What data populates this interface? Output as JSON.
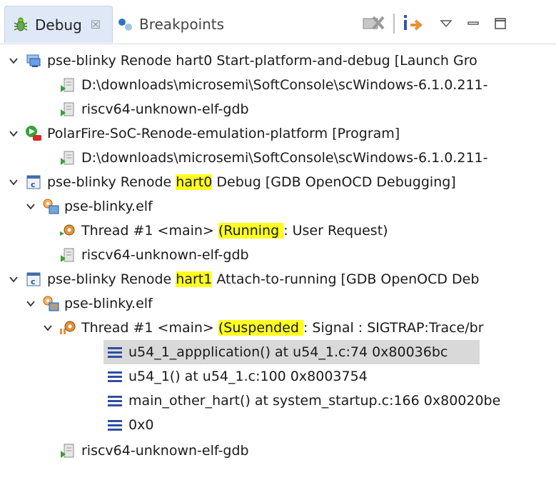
{
  "tabs": {
    "debug_label": "Debug",
    "debug_close": "☒",
    "breakpoints_label": "Breakpoints"
  },
  "tree": {
    "r1": {
      "text": "pse-blinky Renode hart0 Start-platform-and-debug [Launch Gro"
    },
    "r2": {
      "text": "D:\\downloads\\microsemi\\SoftConsole\\scWindows-6.1.0.211-"
    },
    "r3": {
      "text": "riscv64-unknown-elf-gdb"
    },
    "r4": {
      "text": "PolarFire-SoC-Renode-emulation-platform [Program]"
    },
    "r5": {
      "text": "D:\\downloads\\microsemi\\SoftConsole\\scWindows-6.1.0.211-"
    },
    "r6": {
      "pre": "pse-blinky Renode ",
      "hl": "hart0",
      "post": " Debug [GDB OpenOCD Debugging]"
    },
    "r7": {
      "text": "pse-blinky.elf"
    },
    "r8": {
      "pre": "Thread #1 <main> ",
      "hl": "(Running ",
      "post": ": User Request)"
    },
    "r9": {
      "text": "riscv64-unknown-elf-gdb"
    },
    "r10": {
      "pre": "pse-blinky Renode ",
      "hl": "hart1",
      "post": " Attach-to-running [GDB OpenOCD Deb"
    },
    "r11": {
      "text": "pse-blinky.elf"
    },
    "r12": {
      "pre": "Thread #1 <main> ",
      "hl": "(Suspended ",
      "post": ": Signal : SIGTRAP:Trace/br"
    },
    "r13": {
      "text": "u54_1_appplication() at u54_1.c:74 0x80036bc"
    },
    "r14": {
      "text": "u54_1() at u54_1.c:100 0x8003754"
    },
    "r15": {
      "text": "main_other_hart() at system_startup.c:166 0x80020be"
    },
    "r16": {
      "text": "0x0"
    },
    "r17": {
      "text": "riscv64-unknown-elf-gdb"
    }
  },
  "colors": {
    "highlight": "#ffff22",
    "selection": "#d9d9d9",
    "tab_active_bg": "#dfe8f6",
    "stack_frame_icon": "#2f4f9e"
  },
  "icons": [
    "debug-bug-icon",
    "breakpoints-icon",
    "remove-terminated-icon",
    "step-into-icon",
    "view-menu-icon",
    "minimize-icon",
    "maximize-icon",
    "chevron-down-icon",
    "launch-group-icon",
    "process-icon",
    "program-run-icon",
    "c-app-icon",
    "debug-target-icon",
    "thread-icon",
    "stack-frame-icon"
  ]
}
